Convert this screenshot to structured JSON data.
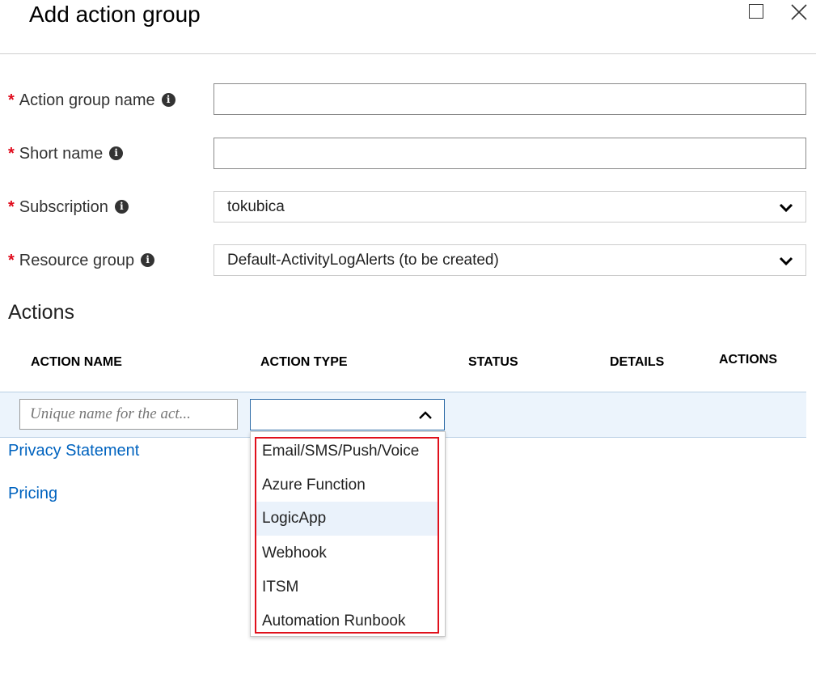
{
  "header": {
    "title": "Add action group",
    "maximize_icon": "maximize-icon",
    "close_icon": "close-icon"
  },
  "form": {
    "required_marker": "*",
    "info_icon": "i",
    "action_group_name": {
      "label": "Action group name",
      "value": ""
    },
    "short_name": {
      "label": "Short name",
      "value": ""
    },
    "subscription": {
      "label": "Subscription",
      "value": "tokubica"
    },
    "resource_group": {
      "label": "Resource group",
      "value": "Default-ActivityLogAlerts (to be created)"
    }
  },
  "actions": {
    "section_title": "Actions",
    "columns": [
      "ACTION NAME",
      "ACTION TYPE",
      "STATUS",
      "DETAILS",
      "ACTIONS"
    ],
    "name_placeholder": "Unique name for the act...",
    "type_value": "",
    "type_options": [
      "Email/SMS/Push/Voice",
      "Azure Function",
      "LogicApp",
      "Webhook",
      "ITSM",
      "Automation Runbook"
    ],
    "hovered_option": "LogicApp"
  },
  "links": {
    "privacy": "Privacy Statement",
    "pricing": "Pricing"
  },
  "colors": {
    "required": "#e00b1c",
    "link": "#0063bf",
    "highlight_border": "#e0101b",
    "row_band": "#ecf4fc"
  }
}
